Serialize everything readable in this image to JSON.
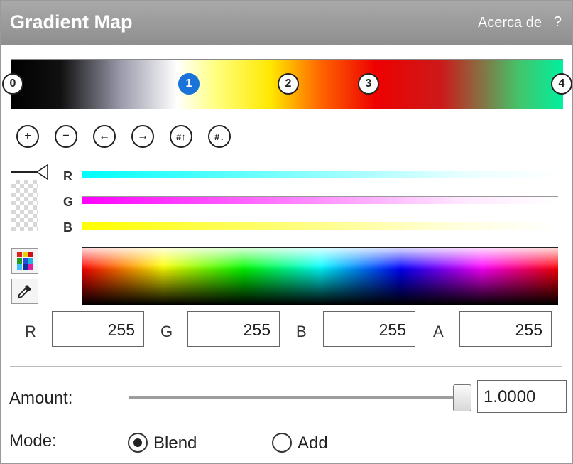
{
  "window": {
    "title": "Gradient Map",
    "about_label": "Acerca de",
    "help_label": "?"
  },
  "gradient": {
    "stops": [
      {
        "label": "0",
        "selected": false
      },
      {
        "label": "1",
        "selected": true
      },
      {
        "label": "2",
        "selected": false
      },
      {
        "label": "3",
        "selected": false
      },
      {
        "label": "4",
        "selected": false
      }
    ]
  },
  "toolbar": {
    "add_icon": "+",
    "remove_icon": "−",
    "left_icon": "←",
    "right_icon": "→",
    "sort_up_icon": "#↑",
    "sort_down_icon": "#↓"
  },
  "channels": {
    "r_label": "R",
    "g_label": "G",
    "b_label": "B"
  },
  "color_values": {
    "r_label": "R",
    "g_label": "G",
    "b_label": "B",
    "a_label": "A",
    "r": "255",
    "g": "255",
    "b": "255",
    "a": "255"
  },
  "amount": {
    "label": "Amount:",
    "value": "1.0000",
    "level": 1.0
  },
  "mode": {
    "label": "Mode:",
    "options": [
      "Blend",
      "Add"
    ],
    "selected": "Blend"
  }
}
